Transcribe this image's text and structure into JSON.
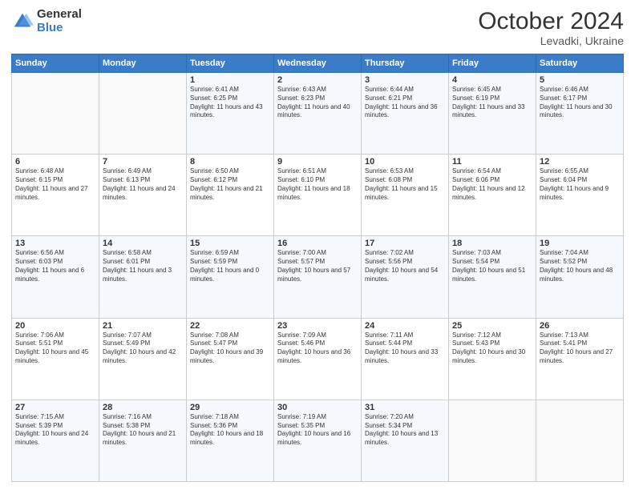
{
  "header": {
    "logo_general": "General",
    "logo_blue": "Blue",
    "month_title": "October 2024",
    "subtitle": "Levadki, Ukraine"
  },
  "days_of_week": [
    "Sunday",
    "Monday",
    "Tuesday",
    "Wednesday",
    "Thursday",
    "Friday",
    "Saturday"
  ],
  "weeks": [
    [
      {
        "day": "",
        "text": ""
      },
      {
        "day": "",
        "text": ""
      },
      {
        "day": "1",
        "text": "Sunrise: 6:41 AM\nSunset: 6:25 PM\nDaylight: 11 hours and 43 minutes."
      },
      {
        "day": "2",
        "text": "Sunrise: 6:43 AM\nSunset: 6:23 PM\nDaylight: 11 hours and 40 minutes."
      },
      {
        "day": "3",
        "text": "Sunrise: 6:44 AM\nSunset: 6:21 PM\nDaylight: 11 hours and 36 minutes."
      },
      {
        "day": "4",
        "text": "Sunrise: 6:45 AM\nSunset: 6:19 PM\nDaylight: 11 hours and 33 minutes."
      },
      {
        "day": "5",
        "text": "Sunrise: 6:46 AM\nSunset: 6:17 PM\nDaylight: 11 hours and 30 minutes."
      }
    ],
    [
      {
        "day": "6",
        "text": "Sunrise: 6:48 AM\nSunset: 6:15 PM\nDaylight: 11 hours and 27 minutes."
      },
      {
        "day": "7",
        "text": "Sunrise: 6:49 AM\nSunset: 6:13 PM\nDaylight: 11 hours and 24 minutes."
      },
      {
        "day": "8",
        "text": "Sunrise: 6:50 AM\nSunset: 6:12 PM\nDaylight: 11 hours and 21 minutes."
      },
      {
        "day": "9",
        "text": "Sunrise: 6:51 AM\nSunset: 6:10 PM\nDaylight: 11 hours and 18 minutes."
      },
      {
        "day": "10",
        "text": "Sunrise: 6:53 AM\nSunset: 6:08 PM\nDaylight: 11 hours and 15 minutes."
      },
      {
        "day": "11",
        "text": "Sunrise: 6:54 AM\nSunset: 6:06 PM\nDaylight: 11 hours and 12 minutes."
      },
      {
        "day": "12",
        "text": "Sunrise: 6:55 AM\nSunset: 6:04 PM\nDaylight: 11 hours and 9 minutes."
      }
    ],
    [
      {
        "day": "13",
        "text": "Sunrise: 6:56 AM\nSunset: 6:03 PM\nDaylight: 11 hours and 6 minutes."
      },
      {
        "day": "14",
        "text": "Sunrise: 6:58 AM\nSunset: 6:01 PM\nDaylight: 11 hours and 3 minutes."
      },
      {
        "day": "15",
        "text": "Sunrise: 6:59 AM\nSunset: 5:59 PM\nDaylight: 11 hours and 0 minutes."
      },
      {
        "day": "16",
        "text": "Sunrise: 7:00 AM\nSunset: 5:57 PM\nDaylight: 10 hours and 57 minutes."
      },
      {
        "day": "17",
        "text": "Sunrise: 7:02 AM\nSunset: 5:56 PM\nDaylight: 10 hours and 54 minutes."
      },
      {
        "day": "18",
        "text": "Sunrise: 7:03 AM\nSunset: 5:54 PM\nDaylight: 10 hours and 51 minutes."
      },
      {
        "day": "19",
        "text": "Sunrise: 7:04 AM\nSunset: 5:52 PM\nDaylight: 10 hours and 48 minutes."
      }
    ],
    [
      {
        "day": "20",
        "text": "Sunrise: 7:06 AM\nSunset: 5:51 PM\nDaylight: 10 hours and 45 minutes."
      },
      {
        "day": "21",
        "text": "Sunrise: 7:07 AM\nSunset: 5:49 PM\nDaylight: 10 hours and 42 minutes."
      },
      {
        "day": "22",
        "text": "Sunrise: 7:08 AM\nSunset: 5:47 PM\nDaylight: 10 hours and 39 minutes."
      },
      {
        "day": "23",
        "text": "Sunrise: 7:09 AM\nSunset: 5:46 PM\nDaylight: 10 hours and 36 minutes."
      },
      {
        "day": "24",
        "text": "Sunrise: 7:11 AM\nSunset: 5:44 PM\nDaylight: 10 hours and 33 minutes."
      },
      {
        "day": "25",
        "text": "Sunrise: 7:12 AM\nSunset: 5:43 PM\nDaylight: 10 hours and 30 minutes."
      },
      {
        "day": "26",
        "text": "Sunrise: 7:13 AM\nSunset: 5:41 PM\nDaylight: 10 hours and 27 minutes."
      }
    ],
    [
      {
        "day": "27",
        "text": "Sunrise: 7:15 AM\nSunset: 5:39 PM\nDaylight: 10 hours and 24 minutes."
      },
      {
        "day": "28",
        "text": "Sunrise: 7:16 AM\nSunset: 5:38 PM\nDaylight: 10 hours and 21 minutes."
      },
      {
        "day": "29",
        "text": "Sunrise: 7:18 AM\nSunset: 5:36 PM\nDaylight: 10 hours and 18 minutes."
      },
      {
        "day": "30",
        "text": "Sunrise: 7:19 AM\nSunset: 5:35 PM\nDaylight: 10 hours and 16 minutes."
      },
      {
        "day": "31",
        "text": "Sunrise: 7:20 AM\nSunset: 5:34 PM\nDaylight: 10 hours and 13 minutes."
      },
      {
        "day": "",
        "text": ""
      },
      {
        "day": "",
        "text": ""
      }
    ]
  ]
}
